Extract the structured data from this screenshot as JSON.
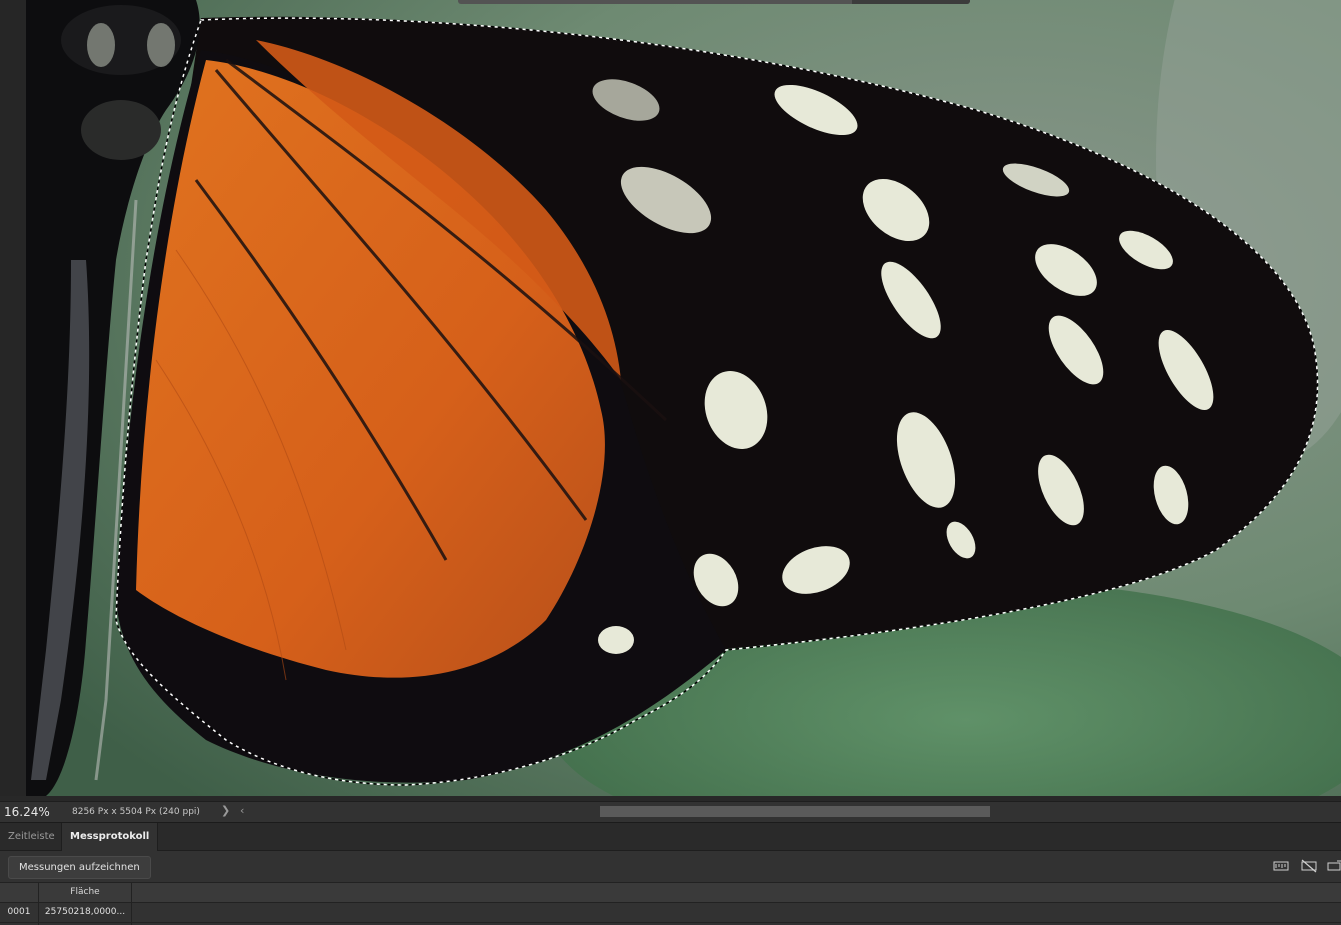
{
  "canvas": {
    "subject": "butterfly wing macro photo with marching-ants selection"
  },
  "statusbar": {
    "zoom": "16.24%",
    "doc_info": "8256 Px x 5504 Px (240 ppi)",
    "arrow_right": "❯",
    "arrow_left": "‹"
  },
  "panel": {
    "tabs": [
      {
        "label": "Zeitleiste",
        "active": false
      },
      {
        "label": "Messprotokoll",
        "active": true
      }
    ],
    "record_button": "Messungen aufzeichnen",
    "toolbar_icons": [
      "select-all-measurements-icon",
      "deselect-measurements-icon",
      "export-measurements-icon"
    ],
    "table": {
      "columns": [
        "",
        "Fläche"
      ],
      "rows": [
        [
          "0001",
          "25750218,0000..."
        ]
      ]
    }
  },
  "colors": {
    "ui_dark": "#282828",
    "panel": "#323232",
    "wing_orange": "#d9651c",
    "wing_black": "#0e0b0c",
    "background_green": "#6d8f70"
  }
}
